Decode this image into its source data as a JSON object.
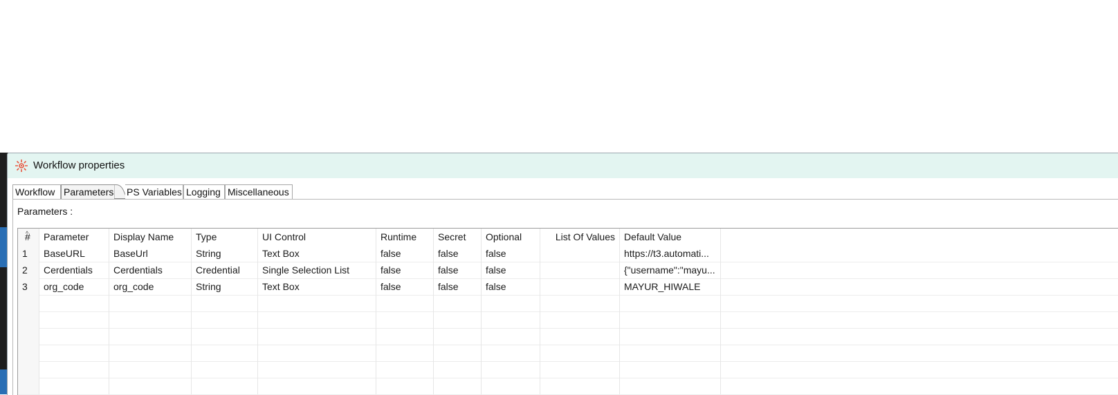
{
  "window": {
    "title": "Workflow properties"
  },
  "tabs": [
    {
      "label": "Workflow"
    },
    {
      "label": "Parameters"
    },
    {
      "label": "PS Variables"
    },
    {
      "label": "Logging"
    },
    {
      "label": "Miscellaneous"
    }
  ],
  "active_tab": "Parameters",
  "parameters_label": "Parameters :",
  "table": {
    "sort_indicator": "^",
    "columns": [
      "#",
      "Parameter",
      "Display Name",
      "Type",
      "UI Control",
      "Runtime",
      "Secret",
      "Optional",
      "List Of Values",
      "Default Value"
    ],
    "rows": [
      [
        "1",
        "BaseURL",
        "BaseUrl",
        "String",
        "Text Box",
        "false",
        "false",
        "false",
        "",
        "https://t3.automati..."
      ],
      [
        "2",
        "Cerdentials",
        "Cerdentials",
        "Credential",
        "Single Selection List",
        "false",
        "false",
        "false",
        "",
        "{\"username\":\"mayu..."
      ],
      [
        "3",
        "org_code",
        "org_code",
        "String",
        "Text Box",
        "false",
        "false",
        "false",
        "",
        "MAYUR_HIWALE"
      ]
    ]
  },
  "icons": {
    "title": "workflow-gear-icon"
  },
  "colors": {
    "titlebar_bg": "#e3f5f1",
    "icon_accent": "#e8563f"
  }
}
